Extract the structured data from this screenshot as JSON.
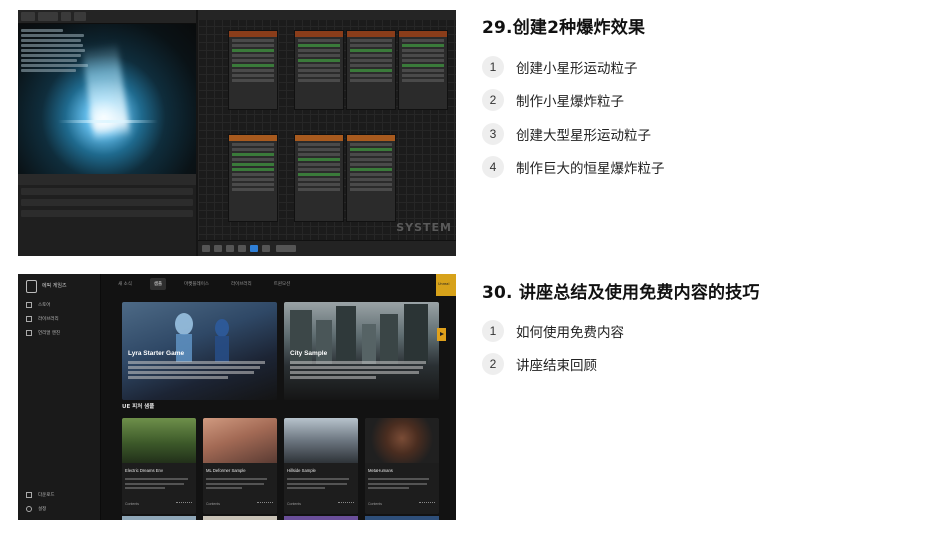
{
  "section1": {
    "title": "29.创建2种爆炸效果",
    "items": [
      {
        "num": "1",
        "text": "创建小星形运动粒子"
      },
      {
        "num": "2",
        "text": "制作小星爆炸粒子"
      },
      {
        "num": "3",
        "text": "创建大型星形运动粒子"
      },
      {
        "num": "4",
        "text": "制作巨大的恒星爆炸粒子"
      }
    ]
  },
  "section2": {
    "title": "30. 讲座总结及使用免费内容的技巧",
    "items": [
      {
        "num": "1",
        "text": "如何使用免费内容"
      },
      {
        "num": "2",
        "text": "讲座结束回顾"
      }
    ]
  },
  "niagara_screenshot": {
    "graph_watermark": "SYSTEM"
  },
  "launcher_screenshot": {
    "brand": "에픽 게임즈",
    "sidebar": [
      "스토어",
      "라이브러리",
      "언리얼 엔진"
    ],
    "sidebar_bottom": [
      "다운로드",
      "설정"
    ],
    "tabs": [
      "새 소식",
      "샘플",
      "마켓플레이스",
      "라이브러리",
      "트윈모션"
    ],
    "active_tab": "샘플",
    "corner_label": "Unreal",
    "hero": [
      {
        "title": "Lyra Starter Game"
      },
      {
        "title": "City Sample"
      }
    ],
    "section_label": "UE 피처 샘플",
    "cards": [
      {
        "title": "Electric Dreams Env",
        "foot": "Contents"
      },
      {
        "title": "ML Deformer Sample",
        "foot": "Contents"
      },
      {
        "title": "Hillside Sample",
        "foot": "Contents"
      },
      {
        "title": "MetaHumans",
        "foot": "Contents"
      }
    ],
    "accent_color": "#e0a11b"
  }
}
